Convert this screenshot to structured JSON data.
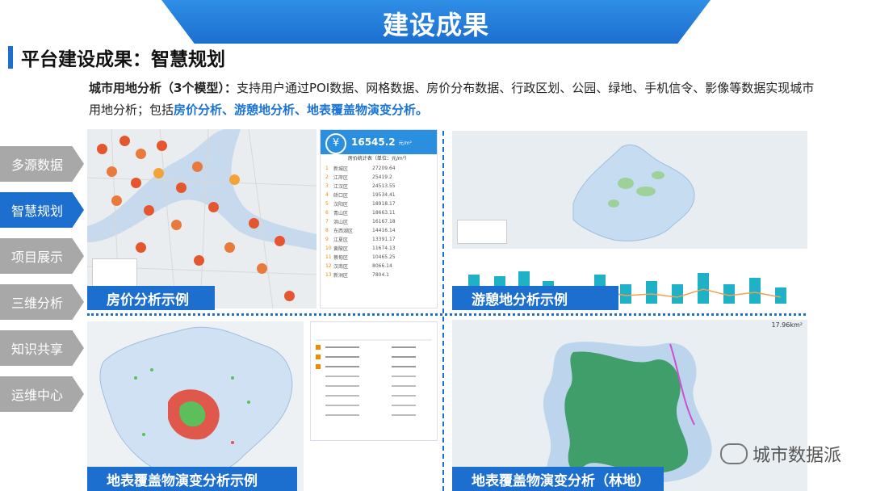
{
  "header": {
    "title": "建设成果"
  },
  "section": {
    "title": "平台建设成果：智慧规划"
  },
  "description": {
    "lead": "城市用地分析（3个模型）：",
    "text1": "支持用户通过POI数据、网格数据、房价分布数据、行政区划、公园、绿地、手机信令、影像等数据实现城市用地分析；包括",
    "highlight": "房价分析、游憩地分析、地表覆盖物演变分析。"
  },
  "sidebar": {
    "items": [
      {
        "label": "多源数据",
        "active": false
      },
      {
        "label": "智慧规划",
        "active": true
      },
      {
        "label": "项目展示",
        "active": false
      },
      {
        "label": "三维分析",
        "active": false
      },
      {
        "label": "知识共享",
        "active": false
      },
      {
        "label": "运维中心",
        "active": false
      }
    ]
  },
  "panels": {
    "price_caption": "房价分析示例",
    "recreation_caption": "游憩地分析示例",
    "landcover_caption": "地表覆盖物演变分析示例",
    "forest_caption": "地表覆盖物演变分析（林地）",
    "price_value": "16545.2",
    "price_unit": "元/m²",
    "forest_value": "17.96km²",
    "price_table": {
      "title": "房价统计表（单位：元/m²）",
      "rows": [
        [
          "1",
          "新城区",
          "27209.64"
        ],
        [
          "2",
          "江岸区",
          "25419.2"
        ],
        [
          "3",
          "江汉区",
          "24513.55"
        ],
        [
          "4",
          "硚口区",
          "19534.41"
        ],
        [
          "5",
          "汉阳区",
          "18918.17"
        ],
        [
          "6",
          "青山区",
          "18663.11"
        ],
        [
          "7",
          "洪山区",
          "16167.18"
        ],
        [
          "8",
          "东西湖区",
          "14416.14"
        ],
        [
          "9",
          "江夏区",
          "13391.17"
        ],
        [
          "10",
          "黄陂区",
          "11674.13"
        ],
        [
          "11",
          "蔡甸区",
          "10465.25"
        ],
        [
          "12",
          "汉南区",
          "8066.14"
        ],
        [
          "13",
          "新洲区",
          "7804.1"
        ]
      ]
    }
  },
  "watermark": "城市数据派",
  "colors": {
    "accent": "#1c6fcf",
    "nav_inactive": "#a8a8a8",
    "highlight": "#1a73d6"
  }
}
